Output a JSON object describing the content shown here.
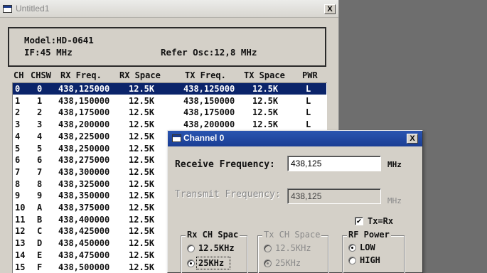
{
  "main_window": {
    "title": "Untitled1",
    "close_label": "X",
    "model": "Model:HD-0641",
    "if": "IF:45 MHz",
    "refer_osc": "Refer Osc:12,8 MHz"
  },
  "table": {
    "headers": [
      "CH",
      "CHSW",
      "RX Freq.",
      "RX Space",
      "TX Freq.",
      "TX Space",
      "PWR"
    ],
    "selected_row": 0,
    "rows": [
      [
        "0",
        "0",
        "438,125000",
        "12.5K",
        "438,125000",
        "12.5K",
        "L"
      ],
      [
        "1",
        "1",
        "438,150000",
        "12.5K",
        "438,150000",
        "12.5K",
        "L"
      ],
      [
        "2",
        "2",
        "438,175000",
        "12.5K",
        "438,175000",
        "12.5K",
        "L"
      ],
      [
        "3",
        "3",
        "438,200000",
        "12.5K",
        "438,200000",
        "12.5K",
        "L"
      ],
      [
        "4",
        "4",
        "438,225000",
        "12.5K",
        "",
        "",
        ""
      ],
      [
        "5",
        "5",
        "438,250000",
        "12.5K",
        "",
        "",
        ""
      ],
      [
        "6",
        "6",
        "438,275000",
        "12.5K",
        "",
        "",
        ""
      ],
      [
        "7",
        "7",
        "438,300000",
        "12.5K",
        "",
        "",
        ""
      ],
      [
        "8",
        "8",
        "438,325000",
        "12.5K",
        "",
        "",
        ""
      ],
      [
        "9",
        "9",
        "438,350000",
        "12.5K",
        "",
        "",
        ""
      ],
      [
        "10",
        "A",
        "438,375000",
        "12.5K",
        "",
        "",
        ""
      ],
      [
        "11",
        "B",
        "438,400000",
        "12.5K",
        "",
        "",
        ""
      ],
      [
        "12",
        "C",
        "438,425000",
        "12.5K",
        "",
        "",
        ""
      ],
      [
        "13",
        "D",
        "438,450000",
        "12.5K",
        "",
        "",
        ""
      ],
      [
        "14",
        "E",
        "438,475000",
        "12.5K",
        "",
        "",
        ""
      ],
      [
        "15",
        "F",
        "438,500000",
        "12.5K",
        "",
        "",
        ""
      ]
    ]
  },
  "dialog": {
    "title": "Channel 0",
    "close_label": "X",
    "receive_label": "Receive Frequency:",
    "receive_value": "438,125",
    "receive_unit": "MHz",
    "transmit_label": "Transmit Frequency:",
    "transmit_value": "438,125",
    "transmit_unit": "MHz",
    "tx_eq_rx_label": "Tx=Rx",
    "tx_eq_rx_checked": true,
    "check_mark": "✔",
    "rx_group": {
      "title": "Rx CH Spac",
      "opt1": "12.5KHz",
      "opt2": "25KHz",
      "selected": "25KHz"
    },
    "tx_group": {
      "title": "Tx CH Space",
      "opt1": "12.5KHz",
      "opt2": "25KHz",
      "selected": "25KHz"
    },
    "rf_group": {
      "title": "RF Power",
      "opt1": "LOW",
      "opt2": "HIGH",
      "selected": "LOW"
    }
  },
  "colors": {
    "selection": "#0b246a",
    "dialog_title": "#1a3d94",
    "window_bg": "#d4d0c8",
    "desktop": "#6e6e6e"
  }
}
